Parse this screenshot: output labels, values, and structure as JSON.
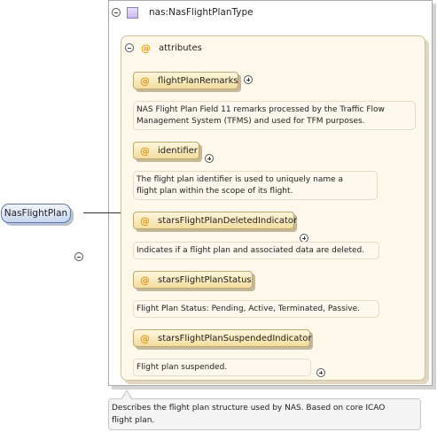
{
  "type": {
    "name": "nas:NasFlightPlanType"
  },
  "attributes_group": {
    "label": "attributes",
    "items": [
      {
        "name": "flightPlanRemarks",
        "doc_lines": [
          "NAS Flight Plan Field 11 remarks processed by the Traffic Flow",
          "Management System (TFMS) and used for TFM purposes."
        ]
      },
      {
        "name": "identifier",
        "doc_lines": [
          "The flight plan identifier is used to uniquely name a",
          "flight plan within the scope of its flight."
        ]
      },
      {
        "name": "starsFlightPlanDeletedIndicator",
        "doc_lines": [
          "Indicates if a flight plan and associated data are deleted."
        ]
      },
      {
        "name": "starsFlightPlanStatus",
        "doc_lines": [
          "Flight Plan Status: Pending, Active, Terminated, Passive."
        ]
      },
      {
        "name": "starsFlightPlanSuspendedIndicator",
        "doc_lines": [
          "Flight plan suspended."
        ]
      }
    ]
  },
  "root_element": {
    "name": "NasFlightPlan"
  },
  "element_doc": {
    "lines": [
      "Describes the flight plan structure used by NAS. Based on core ICAO",
      "flight plan."
    ]
  },
  "symbols": {
    "attribute": "@"
  },
  "colors": {
    "attribute_symbol": "#e39b15",
    "root_element_fill": "#c6d6f0",
    "attributes_box_fill": "#fdf8ea",
    "attribute_pill_fill": "#f2dd9f"
  }
}
